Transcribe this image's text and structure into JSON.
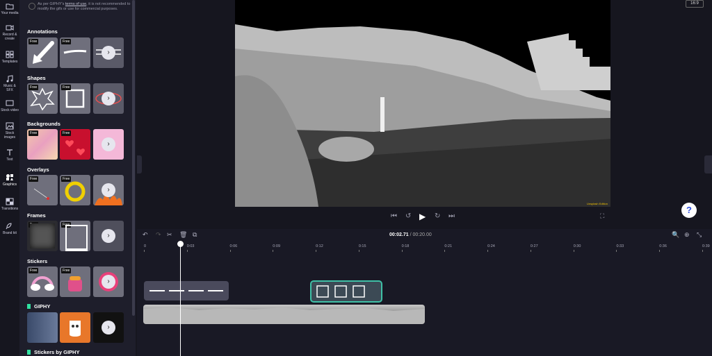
{
  "rail": {
    "items": [
      {
        "label": "Your media",
        "icon": "folder-icon"
      },
      {
        "label": "Record & create",
        "icon": "camera-icon"
      },
      {
        "label": "Templates",
        "icon": "templates-icon"
      },
      {
        "label": "Music & SFX",
        "icon": "music-icon"
      },
      {
        "label": "Stock video",
        "icon": "film-icon"
      },
      {
        "label": "Stock images",
        "icon": "image-icon"
      },
      {
        "label": "Text",
        "icon": "text-icon"
      },
      {
        "label": "Graphics",
        "icon": "shapes-icon"
      },
      {
        "label": "Transitions",
        "icon": "transitions-icon"
      },
      {
        "label": "Brand kit",
        "icon": "brand-icon"
      }
    ]
  },
  "panel": {
    "notice_prefix": "As per GIPHY's ",
    "notice_link": "terms of use",
    "notice_suffix": ", it is not recommended to modify the gifs or use for commercial purposes.",
    "free_badge": "Free",
    "sections": [
      {
        "title": "Annotations"
      },
      {
        "title": "Shapes"
      },
      {
        "title": "Backgrounds"
      },
      {
        "title": "Overlays"
      },
      {
        "title": "Frames"
      },
      {
        "title": "Stickers"
      },
      {
        "title": "GIPHY"
      },
      {
        "title": "Stickers by GIPHY"
      }
    ]
  },
  "preview": {
    "aspect_ratio": "16:9",
    "watermark": "Unsplash Edition"
  },
  "timeline": {
    "current_time": "00:02.71",
    "separator": "/",
    "total_time": "00:20.00",
    "ticks": [
      "0",
      "0:03",
      "0:06",
      "0:09",
      "0:12",
      "0:15",
      "0:18",
      "0:21",
      "0:24",
      "0:27",
      "0:30",
      "0:33",
      "0:36",
      "0:39"
    ]
  },
  "help": {
    "label": "?"
  },
  "colors": {
    "accent": "#7b5cff",
    "clip_selected": "#3fc1a7",
    "background": "#16161f"
  }
}
